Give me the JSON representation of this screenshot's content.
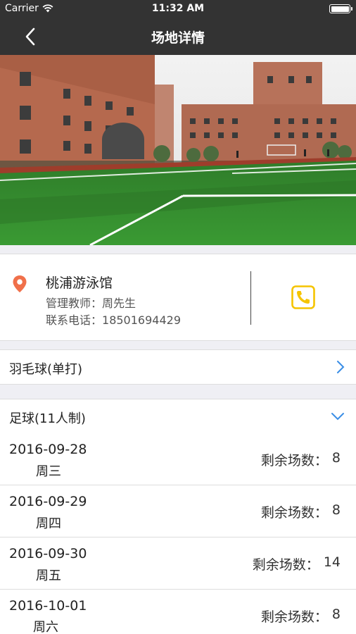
{
  "status_bar": {
    "carrier": "Carrier",
    "time": "11:32 AM"
  },
  "nav": {
    "title": "场地详情"
  },
  "venue": {
    "name": "桃浦游泳馆",
    "manager_label": "管理教师：",
    "manager": "周先生",
    "phone_label": "联系电话：",
    "phone": "18501694429"
  },
  "sports": [
    {
      "label": "羽毛球(单打)",
      "expanded": false
    },
    {
      "label": "足球(11人制)",
      "expanded": true
    }
  ],
  "remaining_label": "剩余场数：",
  "schedule": [
    {
      "date": "2016-09-28",
      "weekday": "周三",
      "remaining": "8"
    },
    {
      "date": "2016-09-29",
      "weekday": "周四",
      "remaining": "8"
    },
    {
      "date": "2016-09-30",
      "weekday": "周五",
      "remaining": "14"
    },
    {
      "date": "2016-10-01",
      "weekday": "周六",
      "remaining": "8"
    }
  ],
  "colors": {
    "nav_bg": "#333333",
    "location_pin": "#f0704a",
    "phone_icon": "#f5c400",
    "chevron": "#3a8ee6"
  },
  "icons": [
    "wifi-icon",
    "battery-icon",
    "back-arrow-icon",
    "location-pin-icon",
    "phone-icon",
    "chevron-right-icon",
    "chevron-down-icon"
  ]
}
